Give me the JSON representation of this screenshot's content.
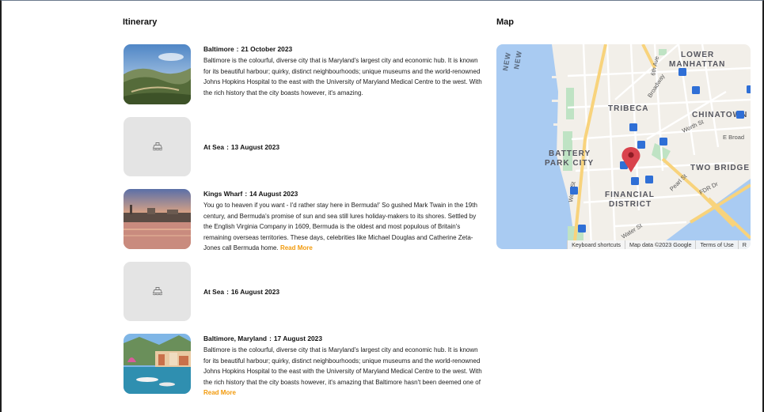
{
  "sections": {
    "itinerary_title": "Itinerary",
    "map_title": "Map"
  },
  "itinerary": [
    {
      "location": "Baltimore",
      "date": "21 October 2023",
      "type": "port",
      "description": "Baltimore is the colourful, diverse city that is Maryland's largest city and economic hub. It is known for its beautiful harbour; quirky, distinct neighbourhoods; unique museums and the world-renowned Johns Hopkins Hospital to the east with the University of Maryland Medical Centre to the west. With the rich history that the city boasts however, it's amazing.",
      "read_more": ""
    },
    {
      "location": "At Sea",
      "date": "13 August 2023",
      "type": "sea",
      "description": "",
      "read_more": ""
    },
    {
      "location": "Kings Wharf",
      "date": "14 August 2023",
      "type": "port",
      "description": "You go to heaven if you want - I'd rather stay here in Bermuda!' So gushed Mark Twain in the 19th century, and Bermuda's promise of sun and sea still lures holiday-makers to its shores. Settled by the English Virginia Company in 1609, Bermuda is the oldest and most populous of Britain's remaining overseas territories. These days, celebrities like Michael Douglas and Catherine Zeta-Jones call Bermuda home.",
      "read_more": "Read More"
    },
    {
      "location": "At Sea",
      "date": "16 August 2023",
      "type": "sea",
      "description": "",
      "read_more": ""
    },
    {
      "location": "Baltimore, Maryland",
      "date": "17 August 2023",
      "type": "port",
      "description": "Baltimore is the colourful, diverse city that is Maryland's largest city and economic hub. It is known for its beautiful harbour; quirky, distinct neighbourhoods; unique museums and the world-renowned Johns Hopkins Hospital to the east with the University of Maryland Medical Centre to the west. With the rich history that the city boasts however, it's amazing that Baltimore hasn't been deemed one of",
      "read_more": "Read More"
    }
  ],
  "separator": ":",
  "map": {
    "labels": {
      "new_jersey_1": "NEW",
      "new_jersey_2": "NEW",
      "lower_manhattan_1": "LOWER",
      "lower_manhattan_2": "MANHATTAN",
      "tribeca": "TRIBECA",
      "chinatown": "CHINATOWN",
      "battery_park_1": "BATTERY",
      "battery_park_2": "PARK CITY",
      "financial_1": "FINANCIAL",
      "financial_2": "DISTRICT",
      "two_bridges": "TWO BRIDGE",
      "fdr": "FDR Dr",
      "broadway": "Broadway",
      "worth_st": "Worth St",
      "e_broad": "E Broad",
      "west_st": "West St",
      "pearl_st": "Pearl St",
      "water_st": "Water St",
      "sixth_ave": "6th Ave"
    },
    "footer": {
      "shortcuts": "Keyboard shortcuts",
      "data": "Map data ©2023 Google",
      "terms": "Terms of Use",
      "report": "R"
    },
    "colors": {
      "water": "#a9cbf2",
      "land": "#f2efe9",
      "park": "#bfe3c4",
      "highway": "#f8d37c",
      "pin": "#d9434d",
      "metro": "#2f6fd6"
    }
  }
}
